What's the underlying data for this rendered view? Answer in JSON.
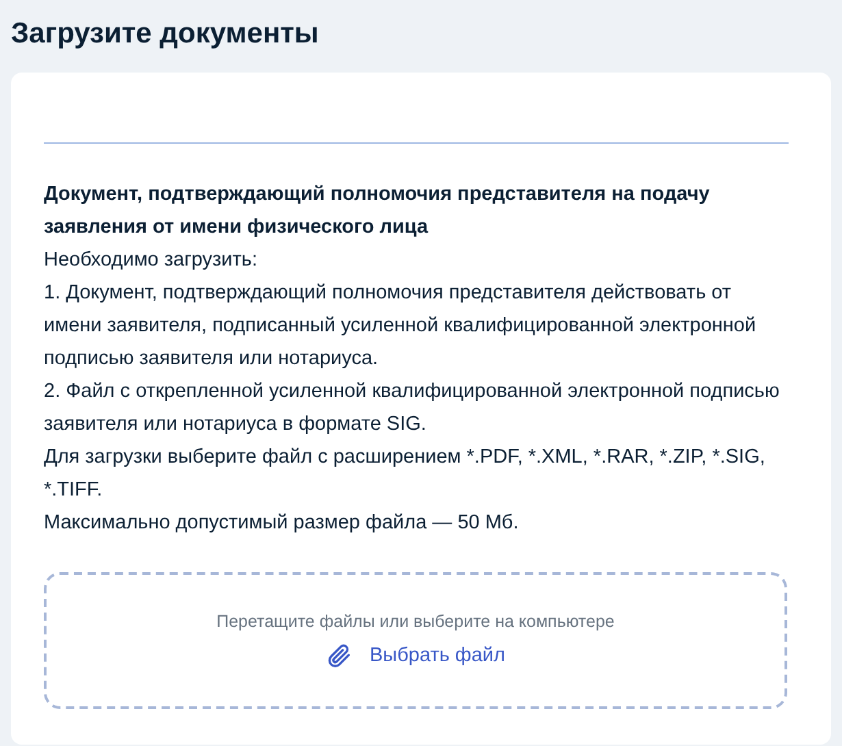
{
  "page_title": "Загрузите документы",
  "document": {
    "title": "Документ, подтверждающий полномочия представителя на подачу заявления от имени физического лица",
    "paragraphs": [
      "Необходимо загрузить:",
      "1. Документ, подтверждающий полномочия представителя действовать от имени заявителя, подписанный усиленной квалифицированной электронной подписью заявителя или нотариуса.",
      "2. Файл с открепленной усиленной квалифицированной электронной подписью заявителя или нотариуса в формате SIG.",
      "Для загрузки выберите файл с расширением *.PDF, *.XML, *.RAR, *.ZIP, *.SIG, *.TIFF.",
      "Максимально допустимый размер файла — 50 Мб."
    ]
  },
  "dropzone": {
    "hint": "Перетащите файлы или выберите на компьютере",
    "button": "Выбрать файл"
  }
}
